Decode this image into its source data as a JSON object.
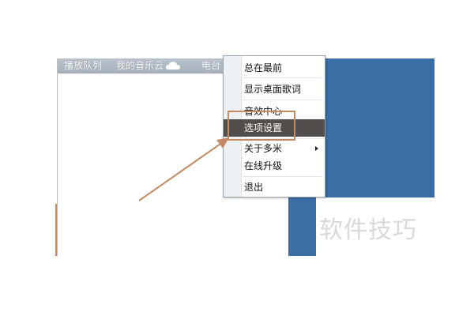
{
  "player": {
    "tabs": [
      {
        "label": "播放队列"
      },
      {
        "label": "我的音乐云"
      },
      {
        "label": "电台"
      }
    ]
  },
  "context_menu": {
    "items": [
      {
        "label": "总在最前"
      },
      {
        "label": "显示桌面歌词"
      },
      {
        "label": "音效中心"
      },
      {
        "label": "选项设置",
        "highlighted": true
      },
      {
        "label": "关于多米",
        "has_submenu": true
      },
      {
        "label": "在线升级"
      },
      {
        "label": "退出"
      }
    ]
  },
  "watermark": "软件技巧",
  "colors": {
    "accent_blue": "#3a6ea5",
    "highlight_bg": "#514e4b",
    "annotation": "#c48a63"
  },
  "icons": {
    "cloud": "cloud-icon",
    "submenu": "chevron-right-icon"
  }
}
